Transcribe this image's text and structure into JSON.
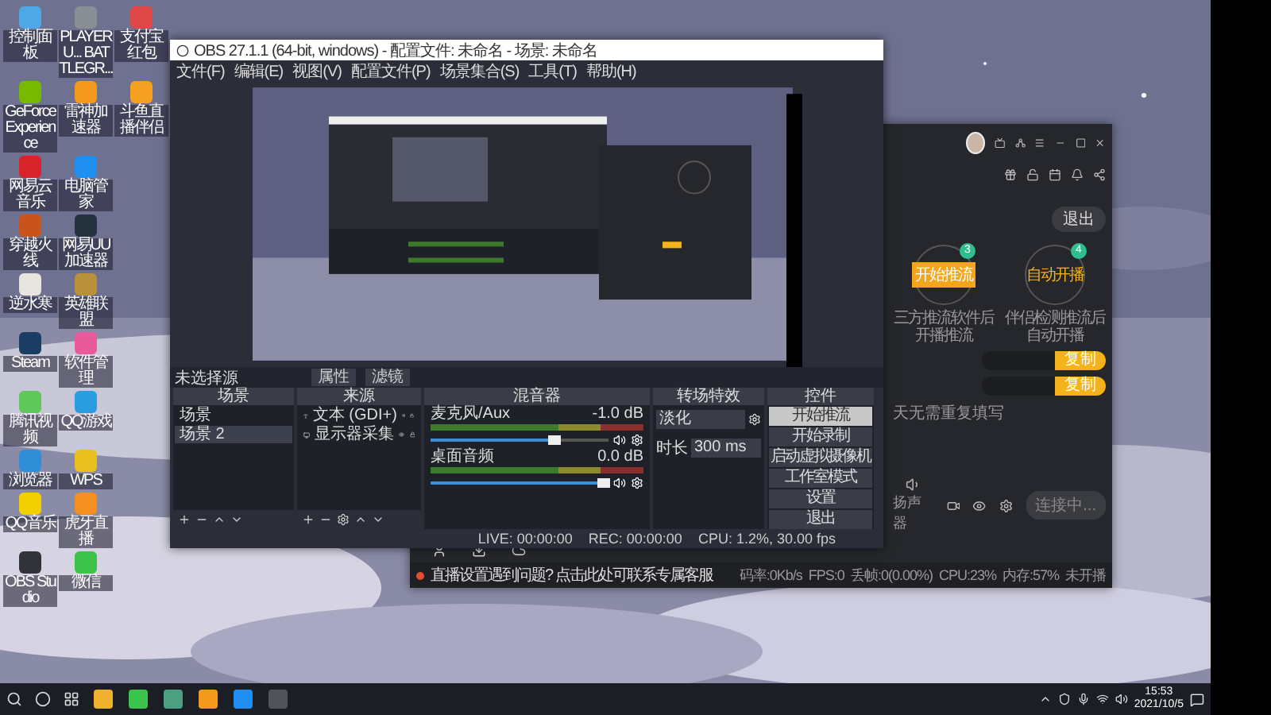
{
  "desktop_rows": [
    [
      {
        "label": "控制面板",
        "color": "#4fa8e6"
      },
      {
        "label": "PLAYERU... BATTLEGR...",
        "color": "#8a8f96"
      },
      {
        "label": "支付宝红包",
        "color": "#e04848"
      }
    ],
    [
      {
        "label": "GeForce Experience",
        "color": "#76b900"
      },
      {
        "label": "雷神加速器",
        "color": "#f39a1e"
      },
      {
        "label": "斗鱼直播伴侣",
        "color": "#f5a020"
      }
    ],
    [
      {
        "label": "网易云音乐",
        "color": "#d8232a"
      },
      {
        "label": "电脑管家",
        "color": "#1e8ff0"
      }
    ],
    [
      {
        "label": "穿越火线",
        "color": "#c8541c"
      },
      {
        "label": "网易UU加速器",
        "color": "#24323e"
      }
    ],
    [
      {
        "label": "逆水寒",
        "color": "#e8e4de"
      },
      {
        "label": "英雄联盟",
        "color": "#b8913a"
      }
    ],
    [
      {
        "label": "Steam",
        "color": "#1b3c63"
      },
      {
        "label": "软件管理",
        "color": "#e85a9a"
      }
    ],
    [
      {
        "label": "腾讯视频",
        "color": "#5ec85a"
      },
      {
        "label": "QQ游戏",
        "color": "#2a9de0"
      }
    ],
    [
      {
        "label": "浏览器",
        "color": "#2f8ed6"
      },
      {
        "label": "WPS",
        "color": "#e8c020"
      }
    ],
    [
      {
        "label": "QQ音乐",
        "color": "#f2d000"
      },
      {
        "label": "虎牙直播",
        "color": "#f59020"
      }
    ],
    [
      {
        "label": "OBS Studio",
        "color": "#303338"
      },
      {
        "label": "微信",
        "color": "#3bc34a"
      }
    ]
  ],
  "obs": {
    "title": "OBS 27.1.1 (64-bit, windows) - 配置文件: 未命名 - 场景: 未命名",
    "menu": [
      "文件(F)",
      "编辑(E)",
      "视图(V)",
      "配置文件(P)",
      "场景集合(S)",
      "工具(T)",
      "帮助(H)"
    ],
    "source_bar": {
      "label": "未选择源",
      "buttons": [
        "属性",
        "滤镜"
      ]
    },
    "scenes": {
      "title": "场景",
      "items": [
        {
          "label": "场景",
          "selected": false
        },
        {
          "label": "场景 2",
          "selected": true
        }
      ]
    },
    "sources": {
      "title": "来源",
      "items": [
        {
          "label": "文本 (GDI+)",
          "kind": "text"
        },
        {
          "label": "显示器采集",
          "kind": "monitor"
        }
      ]
    },
    "mixer": {
      "title": "混音器",
      "channels": [
        {
          "name": "麦克风/Aux",
          "reading": "-1.0 dB",
          "level": 0.7
        },
        {
          "name": "桌面音频",
          "reading": "0.0 dB",
          "level": 0.97
        }
      ]
    },
    "transitions": {
      "title": "转场特效",
      "effect": "淡化",
      "duration_label": "时长",
      "duration": "300 ms"
    },
    "controls": {
      "title": "控件",
      "buttons": [
        {
          "label": "开始推流",
          "selected": true
        },
        {
          "label": "开始录制",
          "selected": false
        },
        {
          "label": "启动虚拟摄像机",
          "selected": false
        },
        {
          "label": "工作室模式",
          "selected": false
        },
        {
          "label": "设置",
          "selected": false
        },
        {
          "label": "退出",
          "selected": false
        }
      ]
    },
    "status": {
      "live": "LIVE: 00:00:00",
      "rec": "REC: 00:00:00",
      "cpu": "CPU: 1.2%, 30.00 fps"
    }
  },
  "stream_app": {
    "exit_button": "退出",
    "modes": [
      {
        "label": "开始推流",
        "caption": "三方推流软件后开播推流",
        "badge": "3",
        "kind": "button"
      },
      {
        "label": "自动开播",
        "caption": "伴侣检测推流后自动开播",
        "badge": "4",
        "kind": "circle"
      }
    ],
    "copy_buttons": [
      "复制",
      "复制"
    ],
    "hint": "天无需重复填写",
    "speaker": "扬声器",
    "connect_button": "连接中...",
    "notice": "直播设置遇到问题? 点击此处可联系专属客服",
    "stats": [
      "码率:0Kb/s",
      "FPS:0",
      "丢帧:0(0.00%)",
      "CPU:23%",
      "内存:57%",
      "未开播"
    ]
  },
  "taskbar": {
    "apps": [
      {
        "color": "#f0b030"
      },
      {
        "color": "#3bc34a"
      },
      {
        "color": "#4aa080"
      },
      {
        "color": "#f39a1e"
      },
      {
        "color": "#1e8ff0"
      },
      {
        "color": "#505458"
      }
    ],
    "time": "15:53",
    "date": "2021/10/5"
  }
}
